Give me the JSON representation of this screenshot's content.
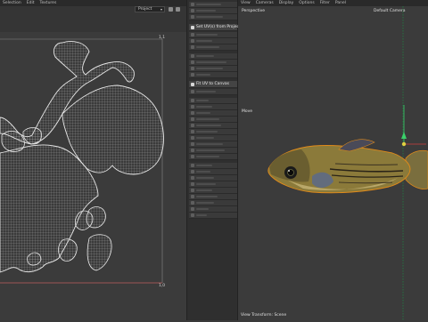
{
  "uv_editor": {
    "menu": [
      "Selection",
      "Edit",
      "Textures"
    ],
    "display_dropdown": "Project",
    "tile_labels": [
      "1,1",
      "1,0"
    ]
  },
  "tool_panel": {
    "section1_title": "Set UV(s) from Projection",
    "section2_title": "Fit UV to Canvas"
  },
  "viewport": {
    "menu": [
      "View",
      "Cameras",
      "Display",
      "Options",
      "Filter",
      "Panel"
    ],
    "perspective_label": "Perspective",
    "camera_label": "Default Camera",
    "axis_label": "Move",
    "status_label": "View Transform: Scene"
  }
}
